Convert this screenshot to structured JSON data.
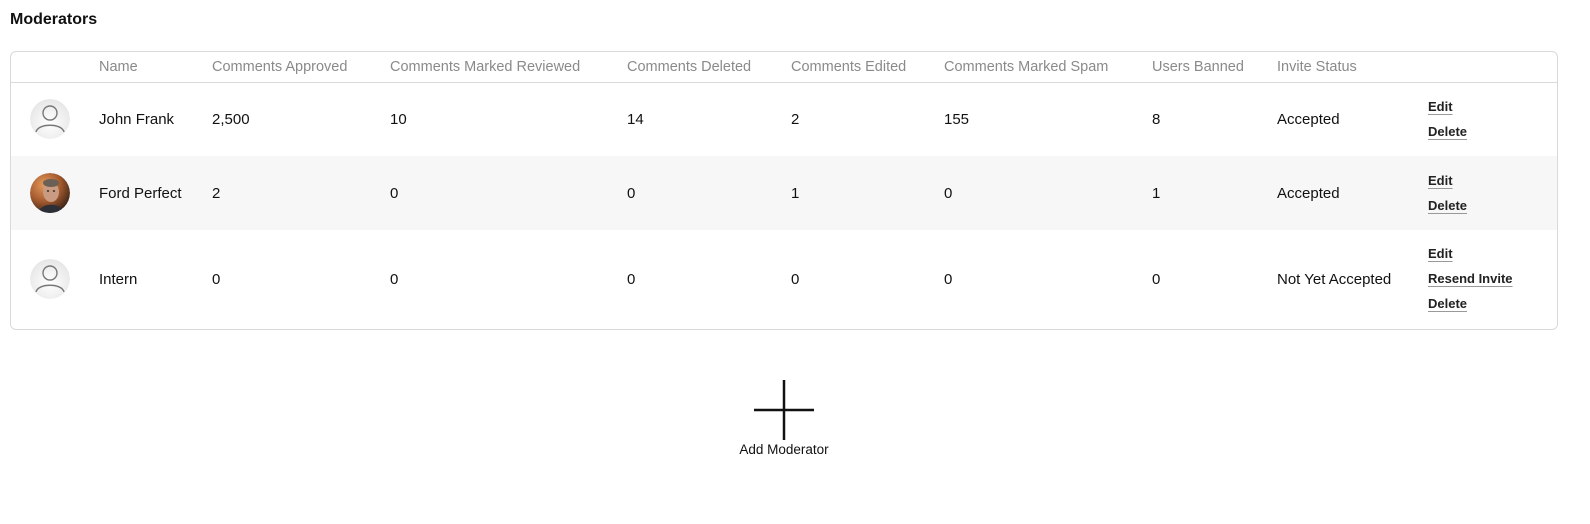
{
  "page": {
    "title": "Moderators"
  },
  "table": {
    "headers": {
      "avatar": "",
      "name": "Name",
      "approved": "Comments Approved",
      "reviewed": "Comments Marked Reviewed",
      "deleted": "Comments Deleted",
      "edited": "Comments Edited",
      "spam": "Comments Marked Spam",
      "banned": "Users Banned",
      "status": "Invite Status"
    },
    "rows": [
      {
        "avatar_icon": "default-user-icon",
        "name": "John Frank",
        "approved": "2,500",
        "reviewed": "10",
        "deleted": "14",
        "edited": "2",
        "spam": "155",
        "banned": "8",
        "status": "Accepted",
        "actions": [
          "Edit",
          "Delete"
        ]
      },
      {
        "avatar_icon": "user-photo",
        "name": "Ford Perfect",
        "approved": "2",
        "reviewed": "0",
        "deleted": "0",
        "edited": "1",
        "spam": "0",
        "banned": "1",
        "status": "Accepted",
        "actions": [
          "Edit",
          "Delete"
        ]
      },
      {
        "avatar_icon": "default-user-icon",
        "name": "Intern",
        "approved": "0",
        "reviewed": "0",
        "deleted": "0",
        "edited": "0",
        "spam": "0",
        "banned": "0",
        "status": "Not Yet Accepted",
        "actions": [
          "Edit",
          "Resend Invite",
          "Delete"
        ]
      }
    ]
  },
  "add_moderator": {
    "label": "Add Moderator",
    "icon": "plus-icon"
  },
  "colors": {
    "header_text": "#8a8a8a",
    "border": "#d9d9d9",
    "stripe": "#f7f7f7"
  }
}
